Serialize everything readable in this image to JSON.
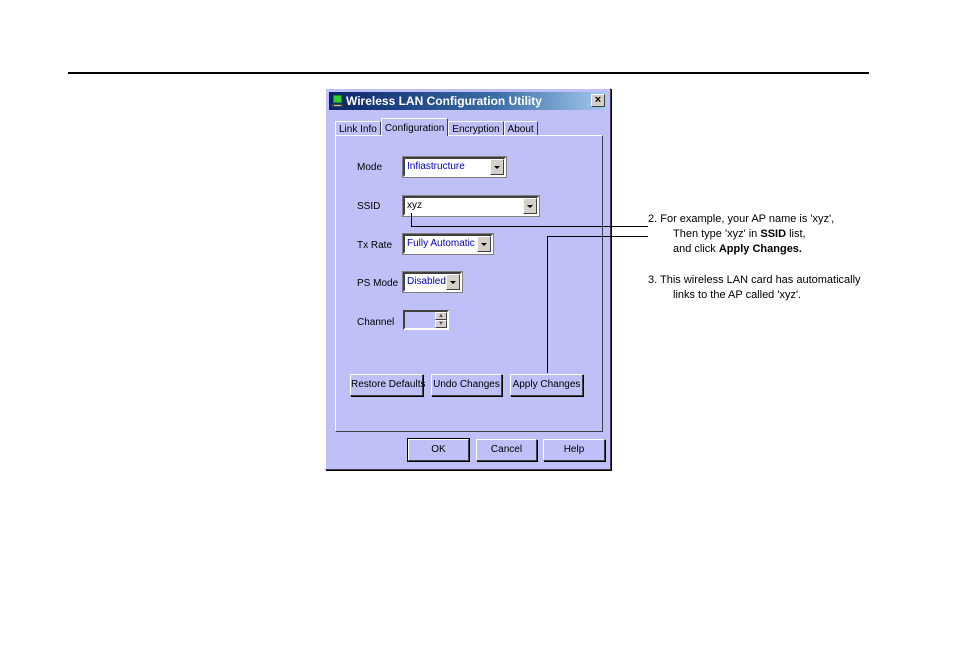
{
  "window": {
    "title": "Wireless LAN Configuration Utility",
    "close_label": "×",
    "bg_color": "#c0c0f8"
  },
  "tabs": [
    {
      "label": "Link Info",
      "active": false
    },
    {
      "label": "Configuration",
      "active": true
    },
    {
      "label": "Encryption",
      "active": false
    },
    {
      "label": "About",
      "active": false
    }
  ],
  "form": {
    "mode": {
      "label": "Mode",
      "value": "Infiastructure"
    },
    "ssid": {
      "label": "SSID",
      "value": "xyz"
    },
    "tx_rate": {
      "label": "Tx Rate",
      "value": "Fully Automatic"
    },
    "ps_mode": {
      "label": "PS Mode",
      "value": "Disabled"
    },
    "channel": {
      "label": "Channel",
      "value": ""
    }
  },
  "panel_buttons": {
    "restore": "Restore Defaults",
    "undo": "Undo Changes",
    "apply": "Apply Changes"
  },
  "dialog_buttons": {
    "ok": "OK",
    "cancel": "Cancel",
    "help": "Help"
  },
  "notes": {
    "step2_line1": "2. For example, your AP name is 'xyz',",
    "step2_line2_pre": "Then type 'xyz' in ",
    "step2_line2_bold": "SSID",
    "step2_line2_post": " list,",
    "step2_line3_pre": "and click ",
    "step2_line3_bold": "Apply Changes.",
    "step3_line1": "3. This wireless LAN card has automatically",
    "step3_line2": "links to the AP called 'xyz'."
  }
}
